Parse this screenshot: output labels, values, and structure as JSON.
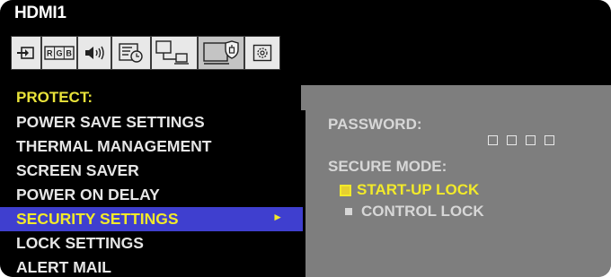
{
  "header": {
    "source": "HDMI1"
  },
  "tabs": [
    {
      "icon": "input-icon"
    },
    {
      "icon": "rgb-picture-icon",
      "text": "RGB"
    },
    {
      "icon": "audio-icon"
    },
    {
      "icon": "schedule-icon"
    },
    {
      "icon": "multi-input-icon"
    },
    {
      "icon": "protect-icon",
      "active": true
    },
    {
      "icon": "system-icon"
    }
  ],
  "menu": {
    "header": "PROTECT:",
    "items": [
      {
        "label": "POWER SAVE SETTINGS"
      },
      {
        "label": "THERMAL MANAGEMENT"
      },
      {
        "label": "SCREEN SAVER"
      },
      {
        "label": "POWER ON DELAY"
      },
      {
        "label": "SECURITY SETTINGS",
        "selected": true,
        "arrow": "►"
      },
      {
        "label": "LOCK SETTINGS"
      },
      {
        "label": "ALERT MAIL"
      }
    ]
  },
  "panel": {
    "password_label": "PASSWORD:",
    "password_slots": 4,
    "secure_mode_label": "SECURE MODE:",
    "options": [
      {
        "label": "START-UP LOCK",
        "selected": true
      },
      {
        "label": "CONTROL LOCK",
        "selected": false
      }
    ]
  },
  "colors": {
    "highlight_text": "#f2ea2a",
    "selection_bg": "#3f3fcf",
    "panel_bg": "#7e7e7e",
    "menu_bg": "#000000"
  }
}
